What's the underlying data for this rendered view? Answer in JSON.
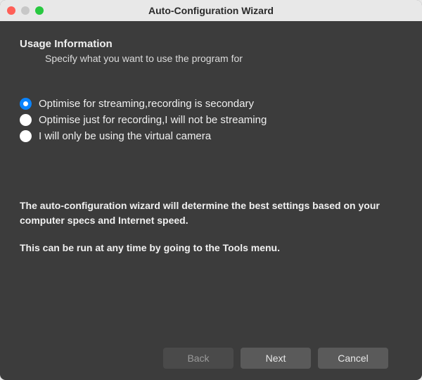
{
  "window": {
    "title": "Auto-Configuration Wizard"
  },
  "section": {
    "heading": "Usage Information",
    "subheading": "Specify what you want to use the program for"
  },
  "options": [
    {
      "label": "Optimise for streaming,recording is secondary",
      "selected": true
    },
    {
      "label": "Optimise just for recording,I will not be streaming",
      "selected": false
    },
    {
      "label": "I will only be using the virtual camera",
      "selected": false
    }
  ],
  "info": {
    "line1": "The auto-configuration wizard will determine the best settings based on your computer specs and Internet speed.",
    "line2": "This can be run at any time by going to the Tools menu."
  },
  "buttons": {
    "back": "Back",
    "next": "Next",
    "cancel": "Cancel"
  },
  "colors": {
    "accent": "#0a84ff",
    "window_bg": "#3c3c3c",
    "titlebar_bg": "#e8e8e8"
  }
}
